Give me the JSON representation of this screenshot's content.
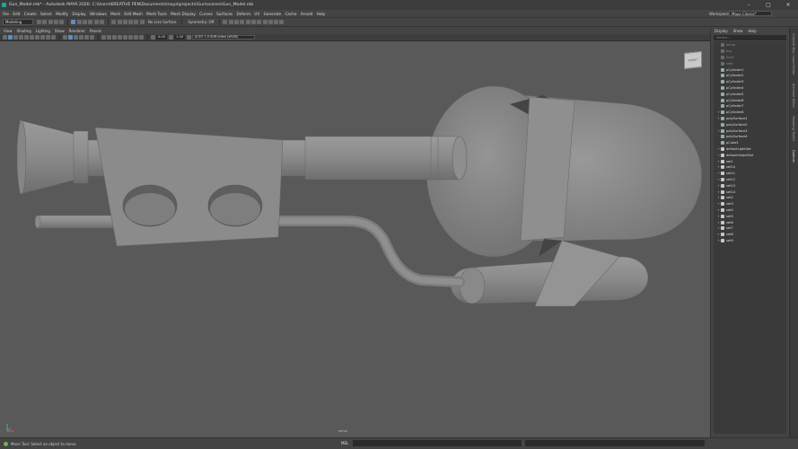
{
  "window": {
    "title": "Gun_Model.mb* - Autodesk MAYA 2026: C:\\Users\\KREATIVE PEN\\Documents\\maya\\projects\\Gun\\scenes\\Gun_Model.mb",
    "controls": [
      "–",
      "□",
      "✕"
    ]
  },
  "menubar": {
    "items": [
      "File",
      "Edit",
      "Create",
      "Select",
      "Modify",
      "Display",
      "Windows",
      "Mesh",
      "Edit Mesh",
      "Mesh Tools",
      "Mesh Display",
      "Curves",
      "Surfaces",
      "Deform",
      "UV",
      "Generate",
      "Cache",
      "Arnold",
      "Help"
    ],
    "workspace_label": "Workspace:",
    "workspace_value": "Maya Classic*"
  },
  "toolbar": {
    "mode": "Modeling",
    "live_surface": "No Live Surface",
    "symmetry": "Symmetry: Off"
  },
  "panel": {
    "menu": [
      "View",
      "Shading",
      "Lighting",
      "Show",
      "Renderer",
      "Panels"
    ],
    "near_value": "0.00",
    "far_value": "1.00",
    "colorspace": "ACES 1.0 SDR-video (sRGB)",
    "camera_label": "persp",
    "viewcube_label": "FRONT"
  },
  "outliner": {
    "menu": [
      "Display",
      "Show",
      "Help"
    ],
    "search_placeholder": "Search...",
    "items": [
      {
        "name": "persp",
        "kind": "ghost"
      },
      {
        "name": "top",
        "kind": "ghost"
      },
      {
        "name": "front",
        "kind": "ghost"
      },
      {
        "name": "side",
        "kind": "ghost"
      },
      {
        "name": "pCylinder1",
        "kind": "mesh"
      },
      {
        "name": "pCylinder2",
        "kind": "mesh"
      },
      {
        "name": "pCylinder3",
        "kind": "mesh"
      },
      {
        "name": "pCylinder4",
        "kind": "mesh"
      },
      {
        "name": "pCylinder5",
        "kind": "mesh"
      },
      {
        "name": "pCylinder6",
        "kind": "mesh"
      },
      {
        "name": "pCylinder7",
        "kind": "mesh"
      },
      {
        "name": "pCylinder8",
        "kind": "mesh"
      },
      {
        "name": "polySurface1",
        "kind": "mesh"
      },
      {
        "name": "polySurface2",
        "kind": "mesh"
      },
      {
        "name": "polySurface3",
        "kind": "mesh"
      },
      {
        "name": "polySurface4",
        "kind": "mesh"
      },
      {
        "name": "pCube1",
        "kind": "mesh"
      },
      {
        "name": "defaultLightSet",
        "kind": "set"
      },
      {
        "name": "defaultObjectSet",
        "kind": "set"
      },
      {
        "name": "set1",
        "kind": "set"
      },
      {
        "name": "set10",
        "kind": "set"
      },
      {
        "name": "set11",
        "kind": "set"
      },
      {
        "name": "set12",
        "kind": "set"
      },
      {
        "name": "set13",
        "kind": "set"
      },
      {
        "name": "set14",
        "kind": "set"
      },
      {
        "name": "set2",
        "kind": "set"
      },
      {
        "name": "set3",
        "kind": "set"
      },
      {
        "name": "set4",
        "kind": "set"
      },
      {
        "name": "set5",
        "kind": "set"
      },
      {
        "name": "set6",
        "kind": "set"
      },
      {
        "name": "set7",
        "kind": "set"
      },
      {
        "name": "set8",
        "kind": "set"
      },
      {
        "name": "set9",
        "kind": "set"
      }
    ]
  },
  "right_tabs": [
    "Channel Box / Layer Editor",
    "Attribute Editor",
    "Modeling Toolkit",
    "Outliner"
  ],
  "statusbar": {
    "help_text": "Move Tool: Select an object to move.",
    "mel_label": "MEL"
  },
  "colors": {
    "ui_bg": "#444444",
    "viewport_bg": "#595959",
    "model_gray": "#8a8a8a",
    "accent_blue": "#5f8fc0"
  }
}
